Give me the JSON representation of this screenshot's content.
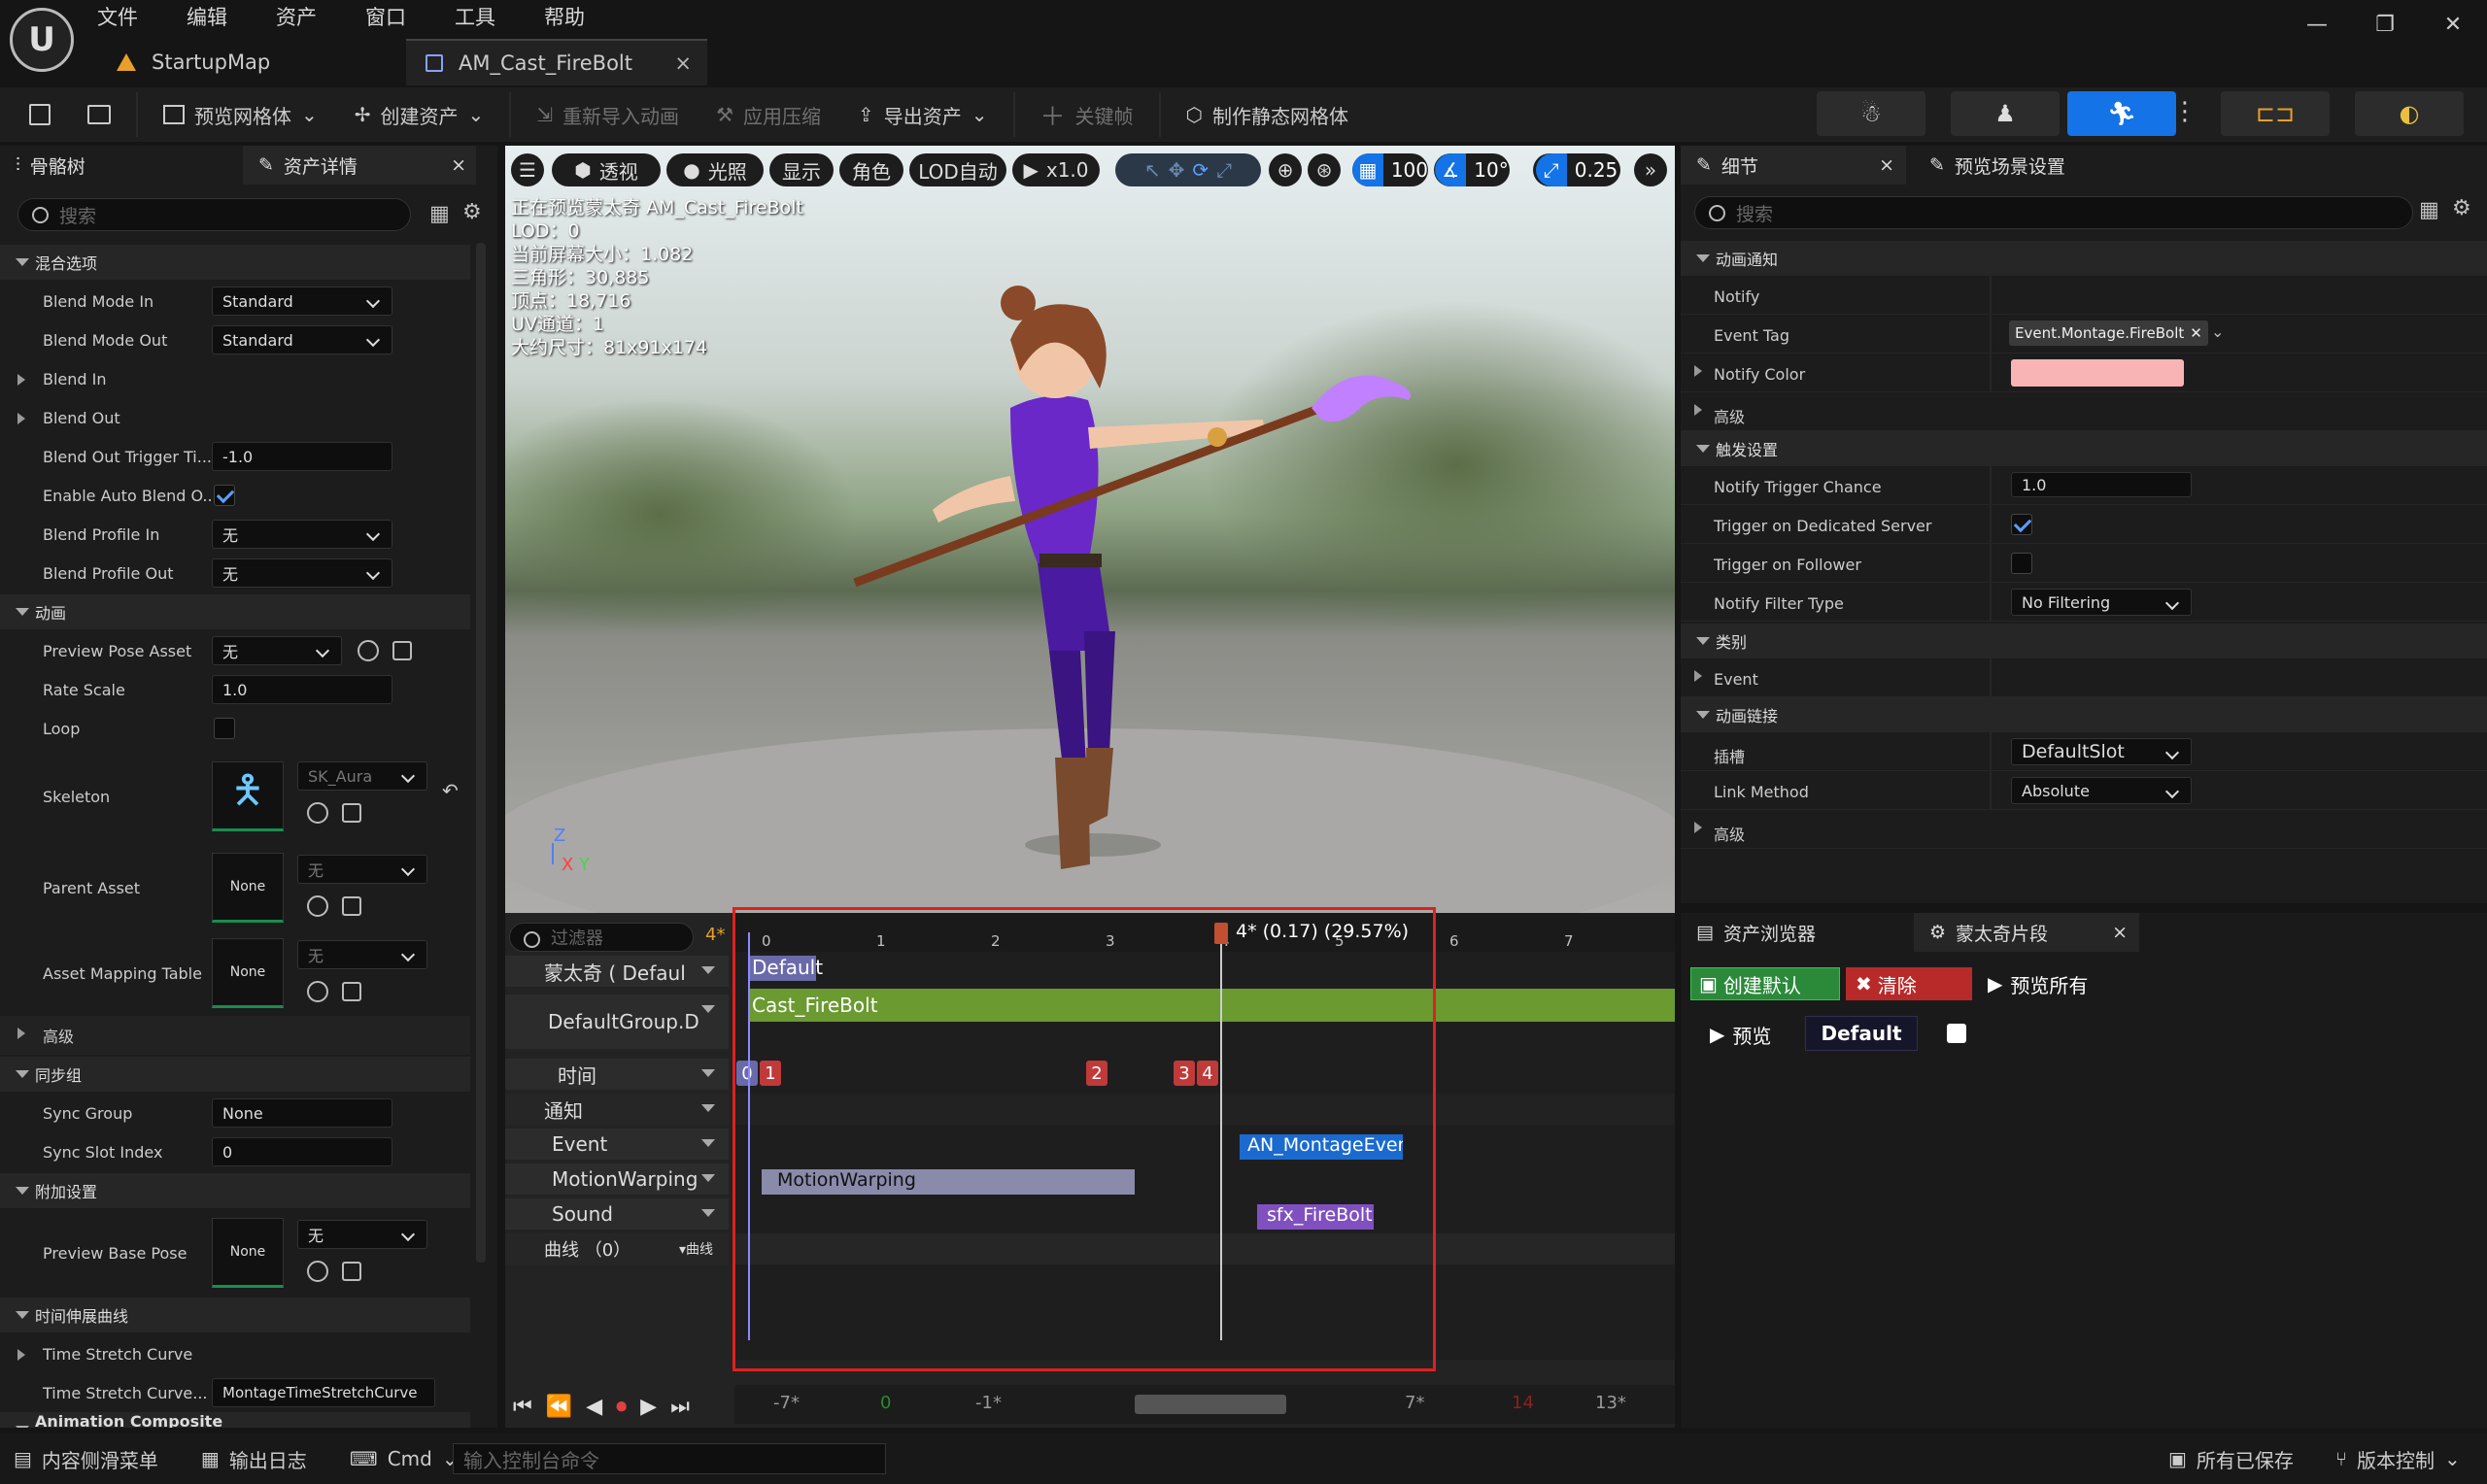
{
  "app": {
    "logo": "U"
  },
  "menu": [
    "文件",
    "编辑",
    "资产",
    "窗口",
    "工具",
    "帮助"
  ],
  "tabs": [
    {
      "label": "StartupMap"
    },
    {
      "label": "AM_Cast_FireBolt",
      "close": "×"
    }
  ],
  "window_controls": [
    "—",
    "❐",
    "✕"
  ],
  "toolbar": {
    "save_icon": "save-icon",
    "preview_mesh": "预览网格体",
    "create_asset": "创建资产",
    "reimport": "重新导入动画",
    "apply_compress": "应用压缩",
    "export_asset": "导出资产",
    "keyframe": "关键帧",
    "make_static_mesh": "制作静态网格体",
    "accent": "#1473e6"
  },
  "left": {
    "tab_skeleton": "骨骼树",
    "tab_details": "资产详情",
    "close": "×",
    "search_placeholder": "搜索",
    "sections": {
      "blend": "混合选项",
      "anim": "动画",
      "sync": "同步组",
      "additive": "附加设置",
      "timestretch": "时间伸展曲线",
      "composite": "Animation Composite"
    },
    "props": {
      "blend_mode_in": "Blend Mode In",
      "blend_mode_in_val": "Standard",
      "blend_mode_out": "Blend Mode Out",
      "blend_mode_out_val": "Standard",
      "blend_in": "Blend In",
      "blend_out": "Blend Out",
      "blend_out_trigger": "Blend Out Trigger Ti...",
      "blend_out_trigger_val": "-1.0",
      "enable_auto_blend": "Enable Auto Blend O...",
      "blend_profile_in": "Blend Profile In",
      "blend_profile_in_val": "无",
      "blend_profile_out": "Blend Profile Out",
      "blend_profile_out_val": "无",
      "preview_pose": "Preview Pose Asset",
      "preview_pose_val": "无",
      "rate_scale": "Rate Scale",
      "rate_scale_val": "1.0",
      "loop": "Loop",
      "skeleton": "Skeleton",
      "skeleton_val": "SK_Aura",
      "parent_asset": "Parent Asset",
      "none": "None",
      "none_dd": "无",
      "asset_mapping": "Asset Mapping Table",
      "advanced": "高级",
      "sync_group": "Sync Group",
      "sync_group_val": "None",
      "sync_slot": "Sync Slot Index",
      "sync_slot_val": "0",
      "preview_base_pose": "Preview Base Pose",
      "time_stretch_curve": "Time Stretch Curve",
      "time_stretch_curve_name": "Time Stretch Curve...",
      "time_stretch_curve_name_val": "MontageTimeStretchCurve"
    }
  },
  "viewport": {
    "buttons": {
      "perspective": "透视",
      "lit": "光照",
      "show": "显示",
      "character": "角色",
      "lod": "LOD自动",
      "speed": "x1.0",
      "grid": "100",
      "angle": "10°",
      "scale": "0.25"
    },
    "info": [
      "正在预览蒙太奇 AM_Cast_FireBolt",
      "LOD：0",
      "当前屏幕大小：1.082",
      "三角形：30,885",
      "顶点：18,716",
      "UV通道：1",
      "大约尺寸：81x91x174"
    ],
    "axes": {
      "z": "Z",
      "x": "X",
      "y": "Y"
    }
  },
  "sequencer": {
    "filter_placeholder": "过滤器",
    "frame_badge": "4*",
    "playhead_label": "4* (0.17) (29.57%)",
    "ticks": [
      "0",
      "1",
      "2",
      "3",
      "4",
      "5",
      "6",
      "7"
    ],
    "tracks": {
      "montage": "蒙太奇 ( Defaul",
      "group": "DefaultGroup.D",
      "time": "时间",
      "notify": "通知",
      "event": "Event",
      "motionwarping": "MotionWarping",
      "sound": "Sound",
      "curves": "曲线 （0）",
      "curves_btn": "曲线"
    },
    "section_default": "Default",
    "segment": "Cast_FireBolt",
    "markers": [
      "0",
      "1",
      "2",
      "3",
      "4"
    ],
    "notifies": {
      "event": "AN_MontageEvent",
      "motionwarping": "MotionWarping",
      "sound": "sfx_FireBolt"
    },
    "bottom_ticks": [
      "-7*",
      "0",
      "-1*",
      "7*",
      "14",
      "13*"
    ]
  },
  "right": {
    "tab_details": "细节",
    "tab_preview": "预览场景设置",
    "close": "×",
    "search_placeholder": "搜索",
    "sections": {
      "notify": "动画通知",
      "trigger": "触发设置",
      "category": "类别",
      "link": "动画链接"
    },
    "props": {
      "notify": "Notify",
      "event_tag": "Event Tag",
      "event_tag_val": "Event.Montage.FireBolt",
      "notify_color": "Notify Color",
      "notify_color_val": "#f8b4b4",
      "advanced": "高级",
      "trigger_chance": "Notify Trigger Chance",
      "trigger_chance_val": "1.0",
      "dedicated": "Trigger on Dedicated Server",
      "follower": "Trigger on Follower",
      "filter_type": "Notify Filter Type",
      "filter_type_val": "No Filtering",
      "event": "Event",
      "slot": "插槽",
      "slot_val": "DefaultSlot",
      "link_method": "Link Method",
      "link_method_val": "Absolute"
    }
  },
  "asset_panel": {
    "tab_browser": "资产浏览器",
    "tab_sections": "蒙太奇片段",
    "close": "×",
    "create_default": "创建默认",
    "clear": "清除",
    "preview_all": "预览所有",
    "preview": "预览",
    "default": "Default"
  },
  "statusbar": {
    "drawer": "内容侧滑菜单",
    "log": "输出日志",
    "cmd": "Cmd",
    "console_placeholder": "输入控制台命令",
    "saved": "所有已保存",
    "vcs": "版本控制"
  }
}
